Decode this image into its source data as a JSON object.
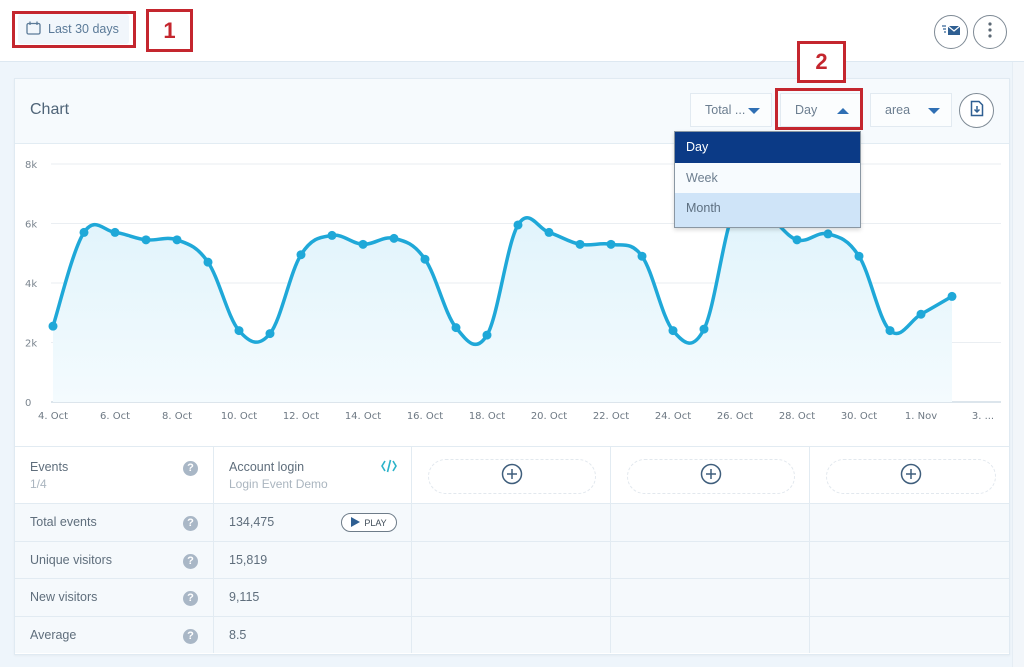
{
  "topbar": {
    "date_range_label": "Last 30 days",
    "icons": [
      "calendar-icon",
      "email-report-icon",
      "more-vertical-icon"
    ]
  },
  "annotations": {
    "one": "1",
    "two": "2"
  },
  "card": {
    "title": "Chart",
    "metric_select": "Total ...",
    "interval_select": "Day",
    "chart_type_select": "area",
    "download_icon": "download-file-icon"
  },
  "interval_dropdown": {
    "options": [
      "Day",
      "Week",
      "Month"
    ],
    "selected": "Day",
    "hovered": "Month"
  },
  "colors": {
    "line": "#1fa8d8",
    "fill": "#e6f6fc",
    "dropdown_selected": "#0b3a86",
    "dropdown_hover": "#cfe4f8",
    "annotation": "#c4262e"
  },
  "chart_data": {
    "type": "area",
    "title": "",
    "xlabel": "",
    "ylabel": "",
    "ylim": [
      0,
      8000
    ],
    "yticks": [
      "0",
      "2k",
      "4k",
      "6k",
      "8k"
    ],
    "xtick_labels": [
      "4. Oct",
      "6. Oct",
      "8. Oct",
      "10. Oct",
      "12. Oct",
      "14. Oct",
      "16. Oct",
      "18. Oct",
      "20. Oct",
      "22. Oct",
      "24. Oct",
      "26. Oct",
      "28. Oct",
      "30. Oct",
      "1. Nov",
      "3. ..."
    ],
    "grid": true,
    "legend": "none",
    "x": [
      "4 Oct",
      "5 Oct",
      "6 Oct",
      "7 Oct",
      "8 Oct",
      "9 Oct",
      "10 Oct",
      "11 Oct",
      "12 Oct",
      "13 Oct",
      "14 Oct",
      "15 Oct",
      "16 Oct",
      "17 Oct",
      "18 Oct",
      "19 Oct",
      "20 Oct",
      "21 Oct",
      "22 Oct",
      "23 Oct",
      "24 Oct",
      "25 Oct",
      "26 Oct",
      "27 Oct",
      "28 Oct",
      "29 Oct",
      "30 Oct",
      "31 Oct",
      "1 Nov",
      "2 Nov"
    ],
    "series": [
      {
        "name": "Total events",
        "values": [
          2550,
          5700,
          5700,
          5450,
          5450,
          4700,
          2400,
          2300,
          4950,
          5600,
          5300,
          5500,
          4800,
          2500,
          2250,
          5950,
          5700,
          5300,
          5300,
          4900,
          2400,
          2450,
          6500,
          6300,
          5450,
          5650,
          4900,
          2400,
          2950,
          3550
        ]
      }
    ]
  },
  "table": {
    "header": {
      "label": "Events",
      "sub": "1/4",
      "event_name": "Account login",
      "event_sub": "Login Event Demo"
    },
    "rows": [
      {
        "label": "Total events",
        "value": "134,475",
        "action": "PLAY"
      },
      {
        "label": "Unique visitors",
        "value": "15,819"
      },
      {
        "label": "New visitors",
        "value": "9,115"
      },
      {
        "label": "Average",
        "value": "8.5"
      }
    ],
    "help_glyph": "?"
  }
}
